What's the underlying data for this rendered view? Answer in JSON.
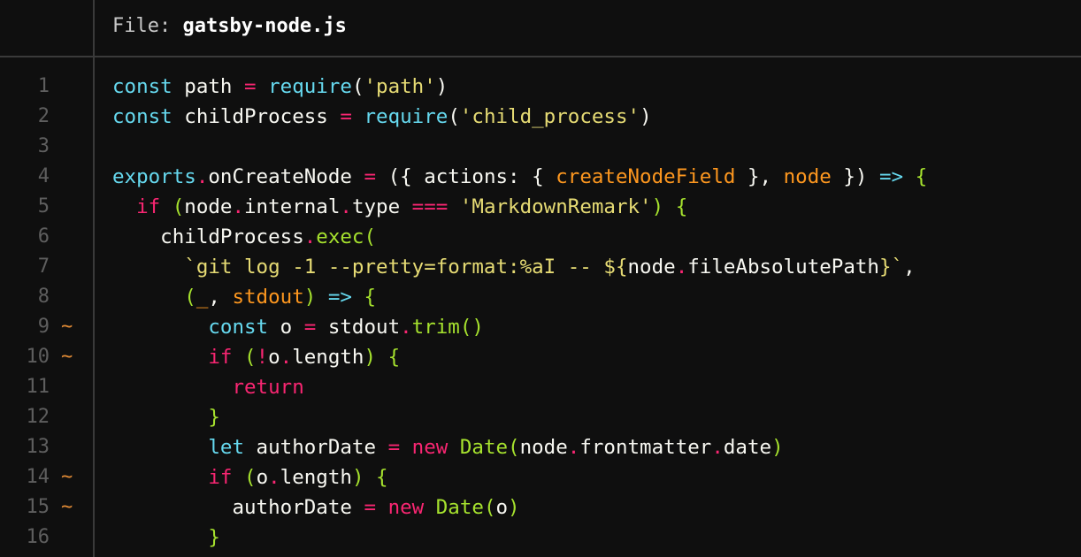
{
  "header": {
    "prefix": "File: ",
    "filename": "gatsby-node.js"
  },
  "colors": {
    "background": "#0f0f0f",
    "divider": "#3a3a3a",
    "line_number": "#5e5e5e",
    "change_marker": "#e08a35",
    "keyword": "#66d9ef",
    "control": "#f92672",
    "function": "#a6e22e",
    "string": "#e6db74",
    "parameter": "#fd971f"
  },
  "lines": [
    {
      "number": "1",
      "marker": "",
      "tokens": [
        {
          "t": "const",
          "c": "kw"
        },
        {
          "t": " path ",
          "c": "plain"
        },
        {
          "t": "=",
          "c": "op"
        },
        {
          "t": " ",
          "c": "plain"
        },
        {
          "t": "require",
          "c": "kw"
        },
        {
          "t": "(",
          "c": "punc"
        },
        {
          "t": "'path'",
          "c": "str"
        },
        {
          "t": ")",
          "c": "punc"
        }
      ]
    },
    {
      "number": "2",
      "marker": "",
      "tokens": [
        {
          "t": "const",
          "c": "kw"
        },
        {
          "t": " childProcess ",
          "c": "plain"
        },
        {
          "t": "=",
          "c": "op"
        },
        {
          "t": " ",
          "c": "plain"
        },
        {
          "t": "require",
          "c": "kw"
        },
        {
          "t": "(",
          "c": "punc"
        },
        {
          "t": "'child_process'",
          "c": "str"
        },
        {
          "t": ")",
          "c": "punc"
        }
      ]
    },
    {
      "number": "3",
      "marker": "",
      "tokens": []
    },
    {
      "number": "4",
      "marker": "",
      "tokens": [
        {
          "t": "exports",
          "c": "kw"
        },
        {
          "t": ".",
          "c": "op"
        },
        {
          "t": "onCreateNode ",
          "c": "plain"
        },
        {
          "t": "=",
          "c": "op"
        },
        {
          "t": " ({ actions: { ",
          "c": "plain"
        },
        {
          "t": "createNodeField",
          "c": "param"
        },
        {
          "t": " }, ",
          "c": "plain"
        },
        {
          "t": "node",
          "c": "param"
        },
        {
          "t": " }) ",
          "c": "plain"
        },
        {
          "t": "=>",
          "c": "kw"
        },
        {
          "t": " ",
          "c": "plain"
        },
        {
          "t": "{",
          "c": "brace"
        }
      ]
    },
    {
      "number": "5",
      "marker": "",
      "tokens": [
        {
          "t": "  ",
          "c": "plain"
        },
        {
          "t": "if",
          "c": "ctrl"
        },
        {
          "t": " ",
          "c": "plain"
        },
        {
          "t": "(",
          "c": "brace"
        },
        {
          "t": "node",
          "c": "plain"
        },
        {
          "t": ".",
          "c": "op"
        },
        {
          "t": "internal",
          "c": "plain"
        },
        {
          "t": ".",
          "c": "op"
        },
        {
          "t": "type ",
          "c": "plain"
        },
        {
          "t": "===",
          "c": "op"
        },
        {
          "t": " ",
          "c": "plain"
        },
        {
          "t": "'MarkdownRemark'",
          "c": "str"
        },
        {
          "t": ")",
          "c": "brace"
        },
        {
          "t": " ",
          "c": "plain"
        },
        {
          "t": "{",
          "c": "brace"
        }
      ]
    },
    {
      "number": "6",
      "marker": "",
      "tokens": [
        {
          "t": "    childProcess",
          "c": "plain"
        },
        {
          "t": ".",
          "c": "op"
        },
        {
          "t": "exec",
          "c": "fn"
        },
        {
          "t": "(",
          "c": "brace"
        }
      ]
    },
    {
      "number": "7",
      "marker": "",
      "tokens": [
        {
          "t": "      ",
          "c": "plain"
        },
        {
          "t": "`git log -1 --pretty=format:%aI -- ",
          "c": "str"
        },
        {
          "t": "${",
          "c": "str"
        },
        {
          "t": "node",
          "c": "plain"
        },
        {
          "t": ".",
          "c": "op"
        },
        {
          "t": "fileAbsolutePath",
          "c": "plain"
        },
        {
          "t": "}`",
          "c": "str"
        },
        {
          "t": ",",
          "c": "plain"
        }
      ]
    },
    {
      "number": "8",
      "marker": "",
      "tokens": [
        {
          "t": "      ",
          "c": "plain"
        },
        {
          "t": "(",
          "c": "brace"
        },
        {
          "t": "_",
          "c": "param"
        },
        {
          "t": ", ",
          "c": "plain"
        },
        {
          "t": "stdout",
          "c": "param"
        },
        {
          "t": ")",
          "c": "brace"
        },
        {
          "t": " ",
          "c": "plain"
        },
        {
          "t": "=>",
          "c": "kw"
        },
        {
          "t": " ",
          "c": "plain"
        },
        {
          "t": "{",
          "c": "brace"
        }
      ]
    },
    {
      "number": "9",
      "marker": "~",
      "tokens": [
        {
          "t": "        ",
          "c": "plain"
        },
        {
          "t": "const",
          "c": "kw"
        },
        {
          "t": " o ",
          "c": "plain"
        },
        {
          "t": "=",
          "c": "op"
        },
        {
          "t": " stdout",
          "c": "plain"
        },
        {
          "t": ".",
          "c": "op"
        },
        {
          "t": "trim",
          "c": "fn"
        },
        {
          "t": "()",
          "c": "brace"
        }
      ]
    },
    {
      "number": "10",
      "marker": "~",
      "tokens": [
        {
          "t": "        ",
          "c": "plain"
        },
        {
          "t": "if",
          "c": "ctrl"
        },
        {
          "t": " ",
          "c": "plain"
        },
        {
          "t": "(",
          "c": "brace"
        },
        {
          "t": "!",
          "c": "op"
        },
        {
          "t": "o",
          "c": "plain"
        },
        {
          "t": ".",
          "c": "op"
        },
        {
          "t": "length",
          "c": "plain"
        },
        {
          "t": ")",
          "c": "brace"
        },
        {
          "t": " ",
          "c": "plain"
        },
        {
          "t": "{",
          "c": "brace"
        }
      ]
    },
    {
      "number": "11",
      "marker": "",
      "tokens": [
        {
          "t": "          ",
          "c": "plain"
        },
        {
          "t": "return",
          "c": "ctrl"
        }
      ]
    },
    {
      "number": "12",
      "marker": "",
      "tokens": [
        {
          "t": "        ",
          "c": "plain"
        },
        {
          "t": "}",
          "c": "brace"
        }
      ]
    },
    {
      "number": "13",
      "marker": "",
      "tokens": [
        {
          "t": "        ",
          "c": "plain"
        },
        {
          "t": "let",
          "c": "kw"
        },
        {
          "t": " authorDate ",
          "c": "plain"
        },
        {
          "t": "=",
          "c": "op"
        },
        {
          "t": " ",
          "c": "plain"
        },
        {
          "t": "new",
          "c": "ctrl"
        },
        {
          "t": " ",
          "c": "plain"
        },
        {
          "t": "Date",
          "c": "fn"
        },
        {
          "t": "(",
          "c": "brace"
        },
        {
          "t": "node",
          "c": "plain"
        },
        {
          "t": ".",
          "c": "op"
        },
        {
          "t": "frontmatter",
          "c": "plain"
        },
        {
          "t": ".",
          "c": "op"
        },
        {
          "t": "date",
          "c": "plain"
        },
        {
          "t": ")",
          "c": "brace"
        }
      ]
    },
    {
      "number": "14",
      "marker": "~",
      "tokens": [
        {
          "t": "        ",
          "c": "plain"
        },
        {
          "t": "if",
          "c": "ctrl"
        },
        {
          "t": " ",
          "c": "plain"
        },
        {
          "t": "(",
          "c": "brace"
        },
        {
          "t": "o",
          "c": "plain"
        },
        {
          "t": ".",
          "c": "op"
        },
        {
          "t": "length",
          "c": "plain"
        },
        {
          "t": ")",
          "c": "brace"
        },
        {
          "t": " ",
          "c": "plain"
        },
        {
          "t": "{",
          "c": "brace"
        }
      ]
    },
    {
      "number": "15",
      "marker": "~",
      "tokens": [
        {
          "t": "          authorDate ",
          "c": "plain"
        },
        {
          "t": "=",
          "c": "op"
        },
        {
          "t": " ",
          "c": "plain"
        },
        {
          "t": "new",
          "c": "ctrl"
        },
        {
          "t": " ",
          "c": "plain"
        },
        {
          "t": "Date",
          "c": "fn"
        },
        {
          "t": "(",
          "c": "brace"
        },
        {
          "t": "o",
          "c": "plain"
        },
        {
          "t": ")",
          "c": "brace"
        }
      ]
    },
    {
      "number": "16",
      "marker": "",
      "tokens": [
        {
          "t": "        ",
          "c": "plain"
        },
        {
          "t": "}",
          "c": "brace"
        }
      ]
    }
  ]
}
